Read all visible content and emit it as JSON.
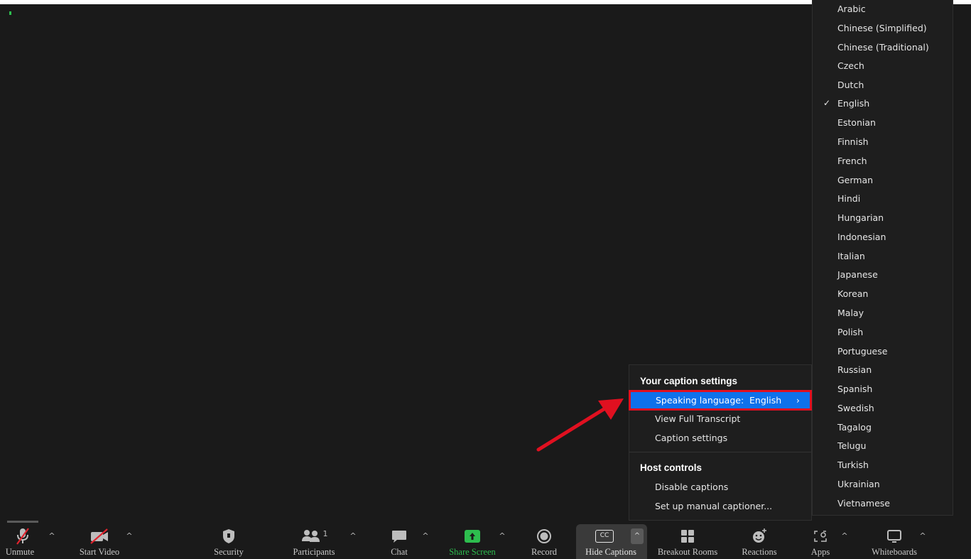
{
  "toolbar": {
    "unmute": "Unmute",
    "start_video": "Start Video",
    "security": "Security",
    "participants": "Participants",
    "participants_count": "1",
    "chat": "Chat",
    "share_screen": "Share Screen",
    "record": "Record",
    "hide_captions": "Hide Captions",
    "cc_badge": "CC",
    "breakout_rooms": "Breakout Rooms",
    "reactions": "Reactions",
    "apps": "Apps",
    "whiteboards": "Whiteboards"
  },
  "caption_menu": {
    "heading": "Your caption settings",
    "speaking_language_label": "Speaking language:",
    "speaking_language_value": "English",
    "view_transcript": "View Full Transcript",
    "caption_settings": "Caption settings",
    "host_heading": "Host controls",
    "disable_captions": "Disable captions",
    "manual_captioner": "Set up manual captioner..."
  },
  "language_menu": {
    "selected": "English",
    "items": [
      "Arabic",
      "Chinese (Simplified)",
      "Chinese (Traditional)",
      "Czech",
      "Dutch",
      "English",
      "Estonian",
      "Finnish",
      "French",
      "German",
      "Hindi",
      "Hungarian",
      "Indonesian",
      "Italian",
      "Japanese",
      "Korean",
      "Malay",
      "Polish",
      "Portuguese",
      "Russian",
      "Spanish",
      "Swedish",
      "Tagalog",
      "Telugu",
      "Turkish",
      "Ukrainian",
      "Vietnamese"
    ]
  },
  "colors": {
    "background": "#1a1a1a",
    "menu_bg": "#1e1e1e",
    "highlight_blue": "#0e71eb",
    "annotation_red": "#e01020",
    "share_green": "#2dbd4e"
  }
}
